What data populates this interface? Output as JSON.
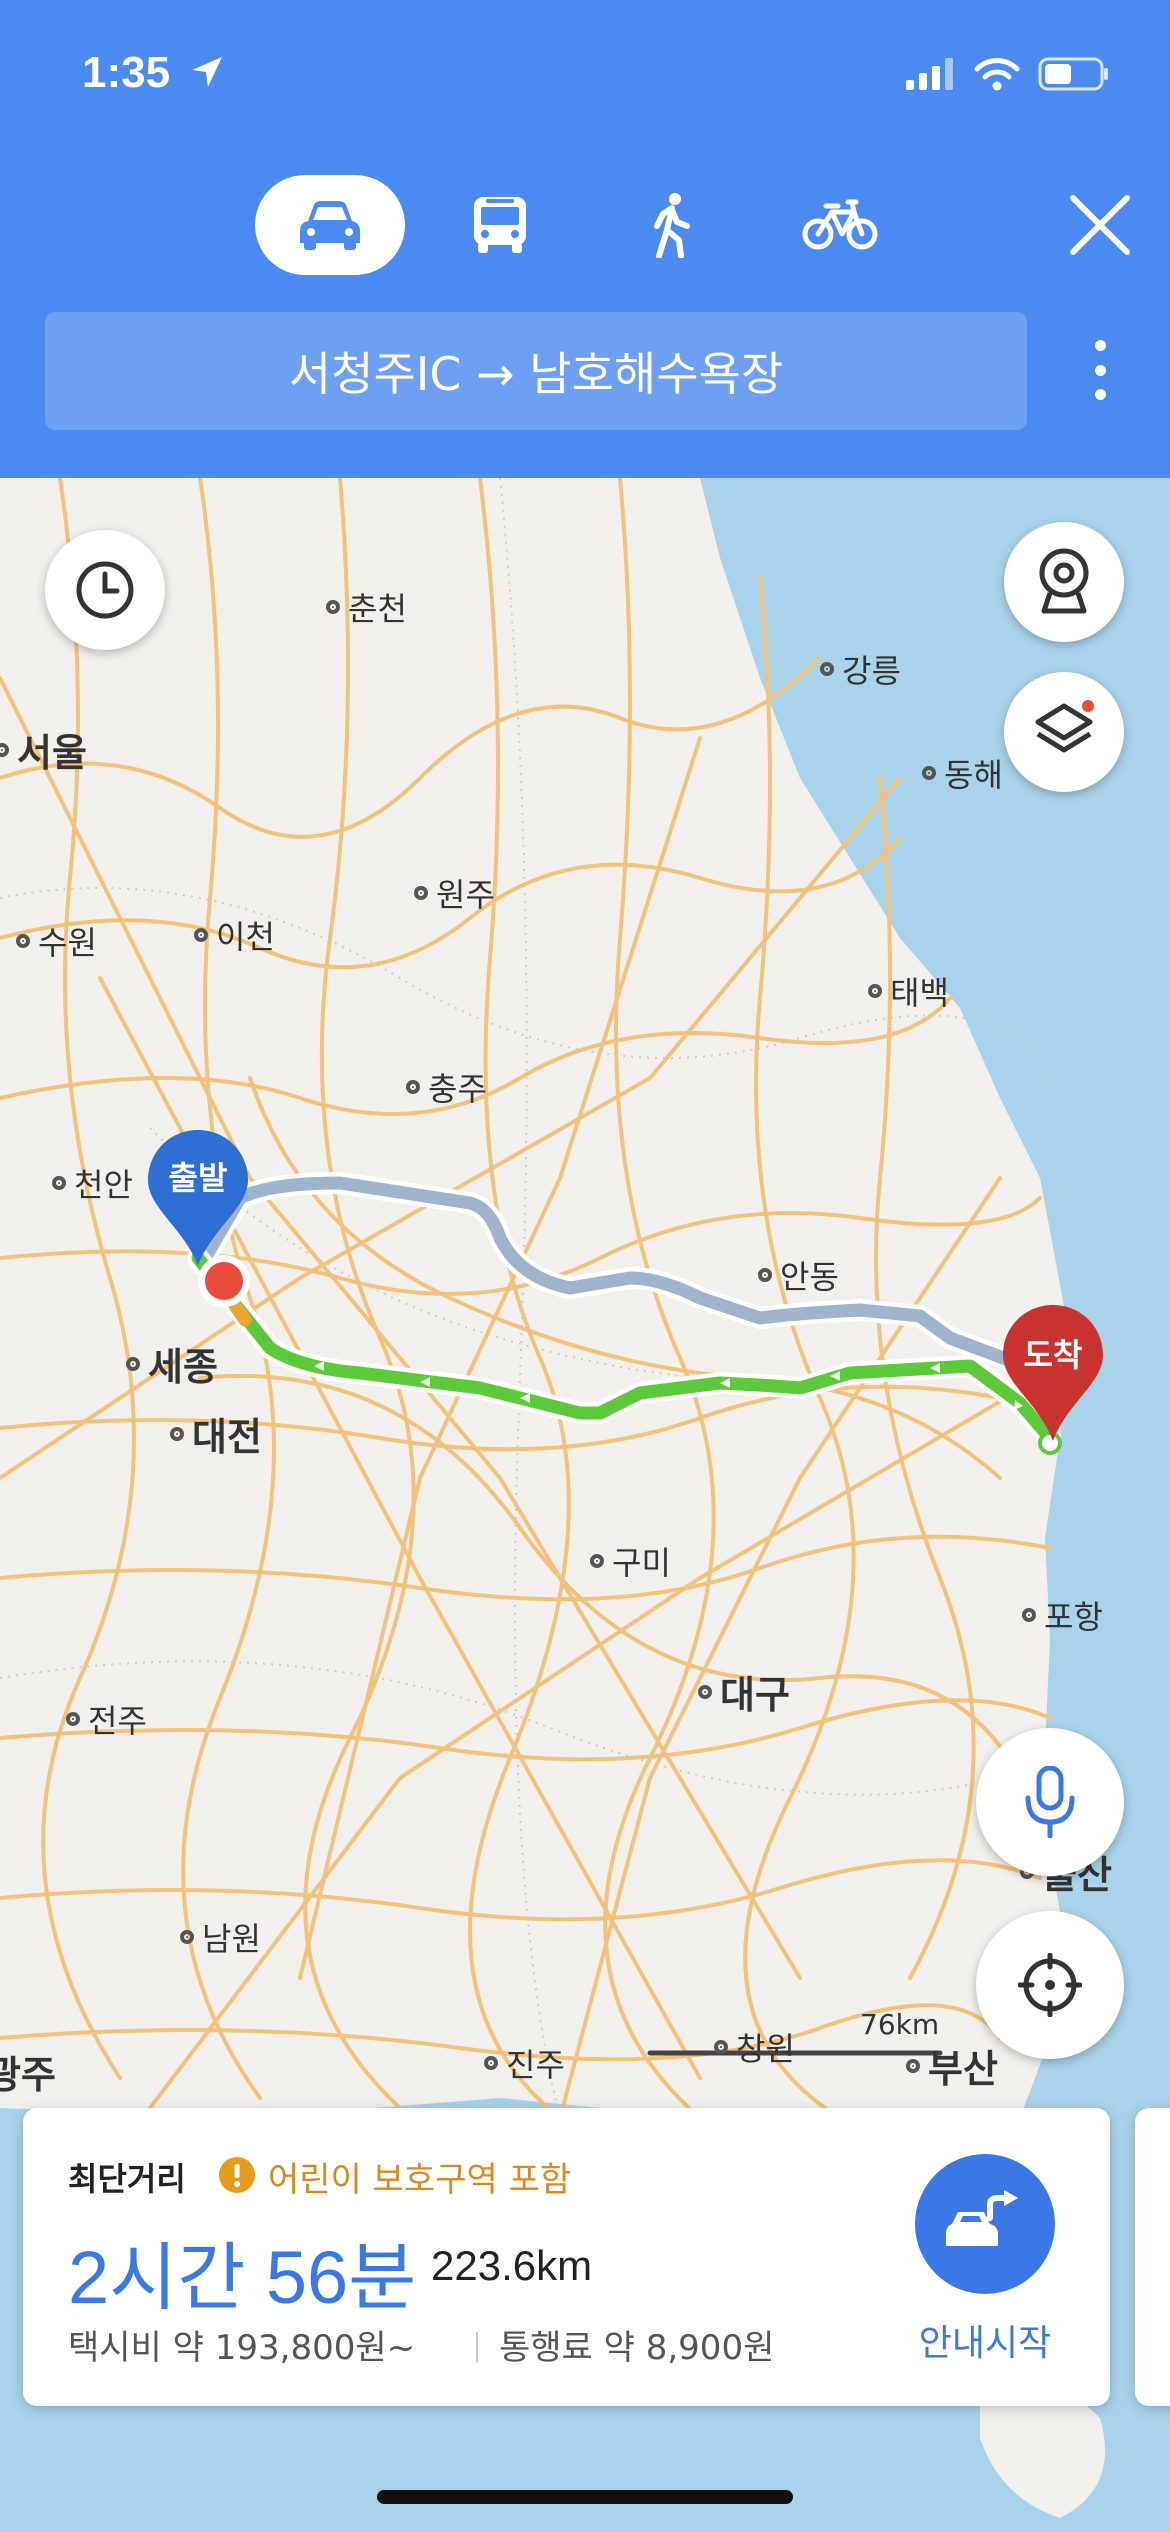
{
  "status": {
    "time": "1:35"
  },
  "transport_modes": [
    {
      "name": "car",
      "active": true
    },
    {
      "name": "bus",
      "active": false
    },
    {
      "name": "walk",
      "active": false
    },
    {
      "name": "bike",
      "active": false
    }
  ],
  "route": {
    "text": "서청주IC → 남호해수욕장"
  },
  "map": {
    "cities": {
      "chuncheon": "춘천",
      "gangneung": "강릉",
      "seoul": "서울",
      "donghae": "동해",
      "wonju": "원주",
      "suwon": "수원",
      "icheon": "이천",
      "taebaek": "태백",
      "chungju": "충주",
      "cheonan": "천안",
      "andong": "안동",
      "sejong": "세종",
      "daejeon": "대전",
      "gumi": "구미",
      "pohang": "포항",
      "daegu": "대구",
      "jeonju": "전주",
      "ulsan": "울산",
      "namwon": "남원",
      "jinju": "진주",
      "changwon": "창원",
      "busan": "부산",
      "gwangju_partial": "광주"
    },
    "start_label": "출발",
    "end_label": "도착",
    "scale_label": "76km",
    "colors": {
      "main_route": "#5cc93a",
      "alt_route": "#9fb3cc",
      "start_pin": "#2e6fd6",
      "end_pin": "#c8332f",
      "sea": "#a8d3ea",
      "roads": "#f3c27a"
    }
  },
  "summary": {
    "route_type": "최단거리",
    "warning": "어린이 보호구역 포함",
    "duration": "2시간 56분",
    "distance": "223.6km",
    "taxi_fare": "택시비 약 193,800원~",
    "toll": "통행료 약 8,900원",
    "start_nav": "안내시작"
  }
}
